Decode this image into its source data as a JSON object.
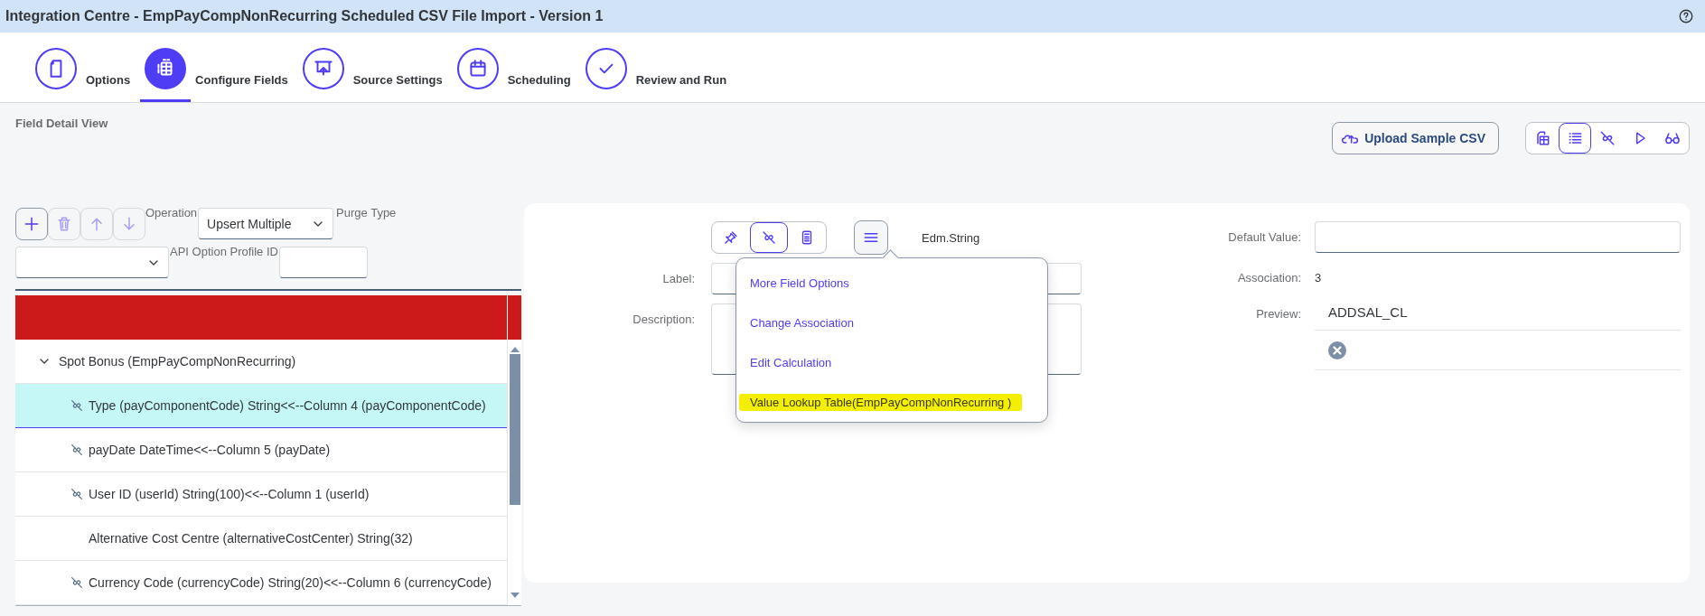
{
  "window": {
    "title": "Integration Centre - EmpPayCompNonRecurring Scheduled CSV File Import - Version 1"
  },
  "steps": [
    {
      "label": "Options",
      "kind": "document",
      "selected": false
    },
    {
      "label": "Configure Fields",
      "kind": "grid",
      "selected": true
    },
    {
      "label": "Source Settings",
      "kind": "upload",
      "selected": false
    },
    {
      "label": "Scheduling",
      "kind": "calendar",
      "selected": false
    },
    {
      "label": "Review and Run",
      "kind": "check",
      "selected": false
    }
  ],
  "view_title": "Field Detail View",
  "upload_button": {
    "label": "Upload Sample CSV"
  },
  "view_toolbar": [
    {
      "kind": "table",
      "selected": false
    },
    {
      "kind": "list",
      "selected": true
    },
    {
      "kind": "mapping",
      "selected": false
    },
    {
      "kind": "run",
      "selected": false
    },
    {
      "kind": "preview",
      "selected": false
    }
  ],
  "field_toolbar": [
    {
      "kind": "add",
      "disabled": false
    },
    {
      "kind": "delete",
      "disabled": true
    },
    {
      "kind": "up",
      "disabled": true
    },
    {
      "kind": "down",
      "disabled": true
    }
  ],
  "operation": {
    "label": "Operation",
    "value": "Upsert Multiple"
  },
  "purge_type": {
    "label": "Purge Type"
  },
  "api_option_profile_id": {
    "label": "API Option Profile ID"
  },
  "tree": [
    {
      "label": "Spot Bonus (EmpPayCompNonRecurring)",
      "kind": "group",
      "expanded": true,
      "selected": false,
      "children": [
        {
          "label": "Type (payComponentCode) String<<--Column 4 (payComponentCode)",
          "kind": "mapped",
          "selected": true
        },
        {
          "label": "payDate DateTime<<--Column 5 (payDate)",
          "kind": "mapped",
          "selected": false
        },
        {
          "label": "User ID (userId) String(100)<<--Column 1 (userId)",
          "kind": "mapped",
          "selected": false
        },
        {
          "label": "Alternative Cost Centre (alternativeCostCenter) String(32)",
          "kind": "plain",
          "selected": false
        },
        {
          "label": "Currency Code (currencyCode) String(20)<<--Column 6 (currencyCode)",
          "kind": "mapped",
          "selected": false
        }
      ]
    }
  ],
  "detail": {
    "mode_buttons": [
      {
        "kind": "pin",
        "selected": false
      },
      {
        "kind": "mapping",
        "selected": true
      },
      {
        "kind": "calculation",
        "selected": false
      }
    ],
    "type": "Edm.String",
    "label_field": {
      "label": "Label:"
    },
    "description_field": {
      "label": "Description:"
    },
    "default_value": {
      "label": "Default Value:"
    },
    "association": {
      "label": "Association:",
      "value": "3"
    },
    "preview": {
      "label": "Preview:",
      "value": "ADDSAL_CL"
    }
  },
  "menu": {
    "items": [
      {
        "label": "More Field Options",
        "highlighted": false
      },
      {
        "label": "Change Association",
        "highlighted": false
      },
      {
        "label": "Edit Calculation",
        "highlighted": false
      },
      {
        "label": "Value Lookup Table(EmpPayCompNonRecurring )",
        "highlighted": true
      }
    ]
  }
}
